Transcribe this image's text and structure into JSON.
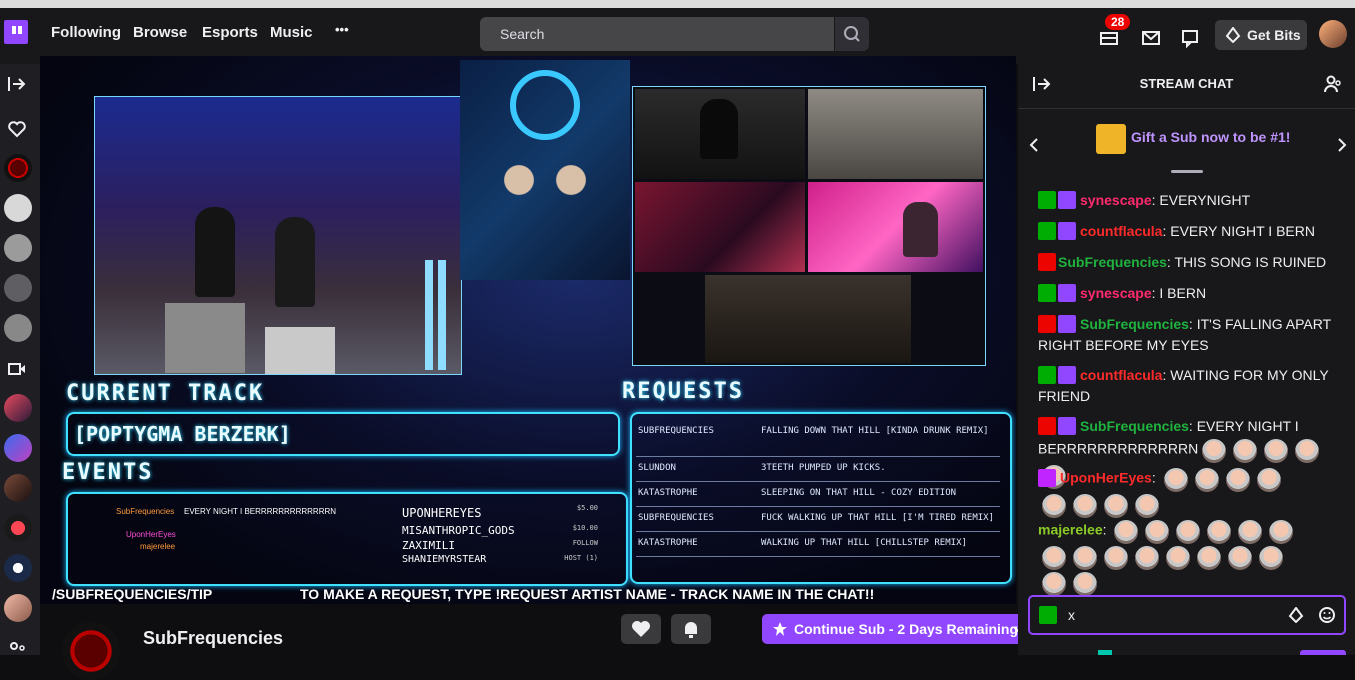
{
  "topnav": {
    "links": [
      "Following",
      "Browse",
      "Esports",
      "Music"
    ],
    "more": "•••",
    "search_placeholder": "Search",
    "notifications_count": "28",
    "get_bits": "Get Bits"
  },
  "player": {
    "current_track_label": "CURRENT TRACK",
    "current_track": "[POPTYGMA BERZERK]",
    "events_label": "EVENTS",
    "requests_label": "REQUESTS",
    "requests": [
      {
        "user": "SUBFREQUENCIES",
        "track": "FALLING DOWN THAT HILL [KINDA DRUNK REMIX]"
      },
      {
        "user": "SLUNDON",
        "track": "3TEETH PUMPED UP KICKS."
      },
      {
        "user": "KATASTROPHE",
        "track": "SLEEPING ON THAT HILL - COZY EDITION"
      },
      {
        "user": "SUBFREQUENCIES",
        "track": "FUCK WALKING UP THAT HILL [I'M TIRED REMIX]"
      },
      {
        "user": "KATASTROPHE",
        "track": "WALKING UP THAT HILL [CHILLSTEP REMIX]"
      }
    ],
    "events": [
      {
        "name": "UPONHEREYES",
        "value": "$5.00"
      },
      {
        "name": "MISANTHROPIC_GODS",
        "value": "$10.00"
      },
      {
        "name": "ZAXIMILI",
        "value": "FOLLOW"
      },
      {
        "name": "SHANIEMYRSTEAR",
        "value": "HOST (1)"
      }
    ],
    "mini_chat": [
      {
        "user": "SubFrequencies",
        "text": "EVERY NIGHT I BERRRRRRRRRRRRRN"
      },
      {
        "user": "UponHerEyes",
        "text": ""
      },
      {
        "user": "majerelee",
        "text": ""
      }
    ],
    "tip_text": "/SUBFREQUENCIES/TIP",
    "request_instructions": "TO MAKE A REQUEST, TYPE !REQUEST ARTIST NAME - TRACK NAME IN THE CHAT!!"
  },
  "channel": {
    "name": "SubFrequencies",
    "continue_sub": "Continue Sub - 2 Days Remaining"
  },
  "chat": {
    "header": "STREAM CHAT",
    "gift_text": "Gift a Sub now to be #1!",
    "messages": [
      {
        "user": "synescape",
        "color": "#ff2a6d",
        "badge": "green",
        "text": "EVERYNIGHT"
      },
      {
        "user": "countflacula",
        "color": "#ff2a2a",
        "badge": "green",
        "text": "EVERY NIGHT I BERN"
      },
      {
        "user": "SubFrequencies",
        "color": "#1fb33e",
        "badge": "red",
        "text": "THIS SONG IS RUINED"
      },
      {
        "user": "synescape",
        "color": "#ff2a6d",
        "badge": "green",
        "text": "I BERN"
      },
      {
        "user": "SubFrequencies",
        "color": "#1fb33e",
        "badge": "red",
        "text": "IT'S FALLING APART RIGHT BEFORE MY EYES"
      },
      {
        "user": "countflacula",
        "color": "#ff2a2a",
        "badge": "green",
        "text": "WAITING FOR MY ONLY FRIEND"
      },
      {
        "user": "SubFrequencies",
        "color": "#1fb33e",
        "badge": "red",
        "text": "EVERY NIGHT I BERRRRRRRRRRRRRN"
      },
      {
        "user": "UponHerEyes",
        "color": "#ff2a2a",
        "badge": "sub",
        "text": ""
      },
      {
        "user": "majerelee",
        "color": "#8ac926",
        "badge": "none",
        "text": ""
      }
    ],
    "input_value": "x"
  }
}
